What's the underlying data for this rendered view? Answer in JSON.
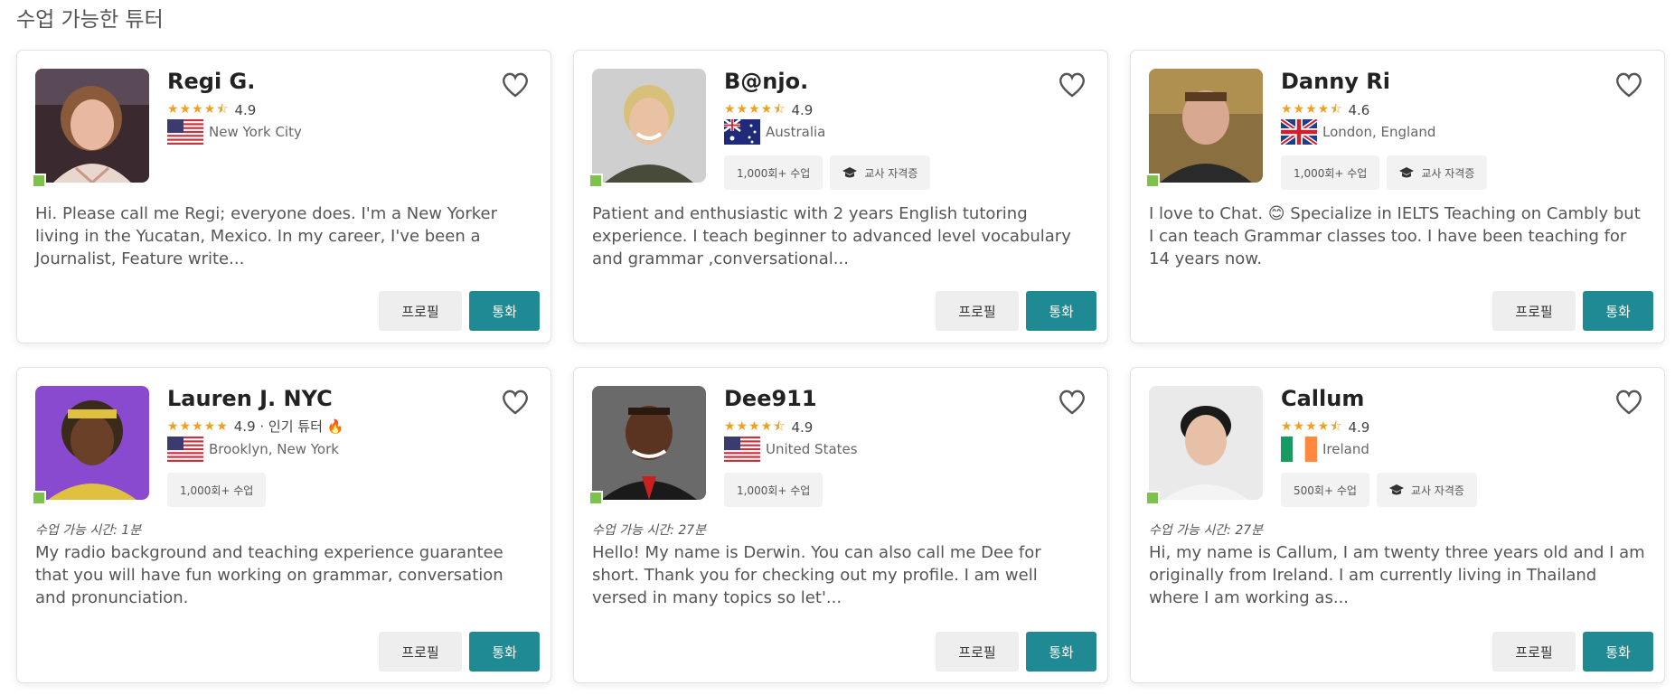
{
  "page": {
    "title": "수업 가능한 튜터"
  },
  "labels": {
    "profile_button": "프로필",
    "call_button": "통화"
  },
  "colors": {
    "accent": "#1f8a93",
    "star": "#f0a020",
    "online": "#7dc24b"
  },
  "tutors": [
    {
      "name": "Regi G.",
      "stars": "★★★★⯪",
      "rating": "4.9",
      "location": "New York City",
      "flag": "US",
      "badges": [],
      "availability": "",
      "description": "Hi. Please call me Regi; everyone does. I'm a New Yorker living in the Yucatan, Mexico. In my career, I've been a Journalist, Feature write..."
    },
    {
      "name": "B@njo.",
      "stars": "★★★★⯪",
      "rating": "4.9",
      "location": "Australia",
      "flag": "AU",
      "badges": [
        "1,000회+ 수업",
        "교사 자격증"
      ],
      "availability": "",
      "description": "Patient and enthusiastic with 2 years English tutoring experience. I teach beginner to advanced level vocabulary and grammar ,conversational..."
    },
    {
      "name": "Danny Ri",
      "stars": "★★★★⯪",
      "rating": "4.6",
      "location": "London, England",
      "flag": "UK",
      "badges": [
        "1,000회+ 수업",
        "교사 자격증"
      ],
      "availability": "",
      "description": "I love to Chat. 😊 Specialize in IELTS Teaching on Cambly but I can teach Grammar classes too. I have been teaching for 14 years now."
    },
    {
      "name": "Lauren J. NYC",
      "stars": "★★★★★",
      "rating": "4.9 · 인기 튜터 🔥",
      "location": "Brooklyn, New York",
      "flag": "US",
      "badges": [
        "1,000회+ 수업"
      ],
      "availability": "수업 가능 시간: 1분",
      "description": "My radio background and teaching experience guarantee that you will have fun working on grammar, conversation and pronunciation."
    },
    {
      "name": "Dee911",
      "stars": "★★★★⯪",
      "rating": "4.9",
      "location": "United States",
      "flag": "US",
      "badges": [
        "1,000회+ 수업"
      ],
      "availability": "수업 가능 시간: 27분",
      "description": "Hello! My name is Derwin. You can also call me Dee for short. Thank you for checking out my profile. I am well versed in many topics so let'..."
    },
    {
      "name": "Callum",
      "stars": "★★★★⯪",
      "rating": "4.9",
      "location": "Ireland",
      "flag": "IE",
      "badges": [
        "500회+ 수업",
        "교사 자격증"
      ],
      "availability": "수업 가능 시간: 27분",
      "description": "Hi, my name is Callum, I am twenty three years old and I am originally from Ireland. I am currently living in Thailand where I am working as..."
    }
  ]
}
